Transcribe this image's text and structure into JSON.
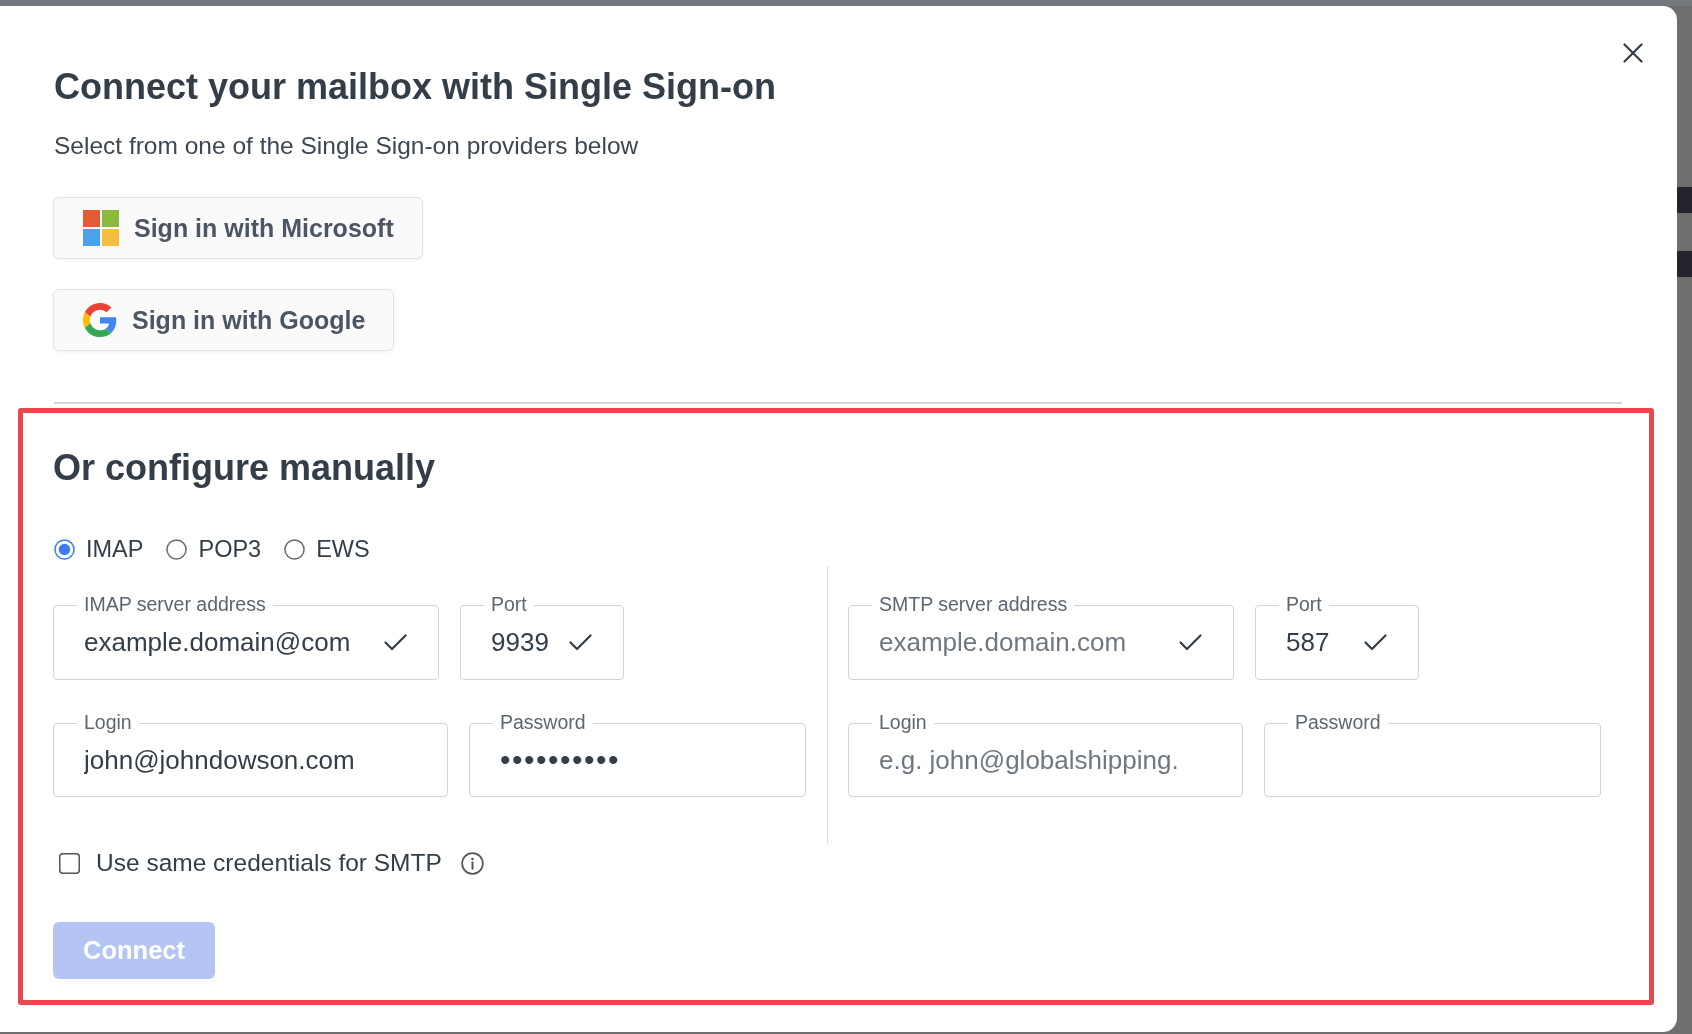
{
  "dialog": {
    "title": "Connect your mailbox with Single Sign-on",
    "subtitle": "Select from one of the Single Sign-on providers below",
    "sso_buttons": [
      {
        "kind": "microsoft",
        "label": "Sign in with Microsoft"
      },
      {
        "kind": "google",
        "label": "Sign in with Google"
      }
    ]
  },
  "manual_setup": {
    "highlighted": true,
    "heading": "Or configure manually",
    "protocols": [
      {
        "label": "IMAP",
        "selected": true
      },
      {
        "label": "POP3",
        "selected": false
      },
      {
        "label": "EWS",
        "selected": false
      }
    ],
    "columns": [
      {
        "rows": [
          {
            "fields": [
              {
                "kind": "server",
                "label": "IMAP server address",
                "value": "example.domain@com",
                "valid": true
              },
              {
                "kind": "port",
                "label": "Port",
                "value": "9939",
                "valid": true
              }
            ]
          },
          {
            "fields": [
              {
                "kind": "login",
                "label": "Login",
                "value": "john@johndowson.com",
                "valid": false
              },
              {
                "kind": "password",
                "label": "Password",
                "value": "••••••••••",
                "valid": false
              }
            ]
          }
        ]
      },
      {
        "rows": [
          {
            "fields": [
              {
                "kind": "server",
                "label": "SMTP server address",
                "placeholder": "example.domain.com",
                "valid": true
              },
              {
                "kind": "port",
                "label": "Port",
                "value": "587",
                "valid": true
              }
            ]
          },
          {
            "fields": [
              {
                "kind": "login",
                "label": "Login",
                "placeholder": "e.g. john@globalshipping.",
                "valid": false
              },
              {
                "kind": "password",
                "label": "Password",
                "valid": false
              }
            ]
          }
        ]
      }
    ],
    "same_credentials": {
      "label": "Use same credentials for SMTP",
      "checked": false
    },
    "connect_button": {
      "label": "Connect",
      "disabled": true
    }
  }
}
